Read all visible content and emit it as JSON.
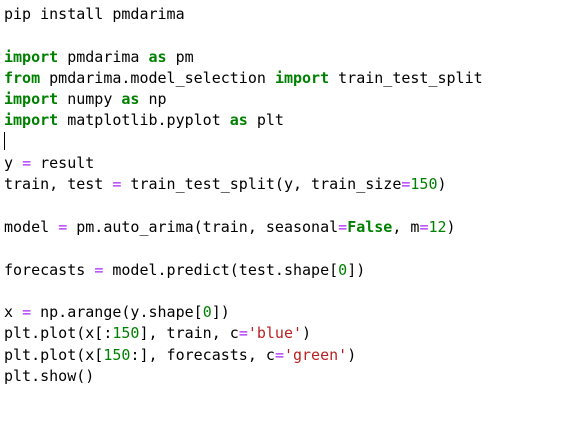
{
  "cell": {
    "lines": [
      {
        "tokens": [
          {
            "t": "pip install pmdarima",
            "c": "plain"
          }
        ]
      },
      {
        "tokens": []
      },
      {
        "tokens": [
          {
            "t": "import",
            "c": "kw"
          },
          {
            "t": " pmdarima ",
            "c": "plain"
          },
          {
            "t": "as",
            "c": "kw"
          },
          {
            "t": " pm",
            "c": "plain"
          }
        ]
      },
      {
        "tokens": [
          {
            "t": "from",
            "c": "kw"
          },
          {
            "t": " pmdarima.model_selection ",
            "c": "plain"
          },
          {
            "t": "import",
            "c": "kw"
          },
          {
            "t": " train_test_split",
            "c": "plain"
          }
        ]
      },
      {
        "tokens": [
          {
            "t": "import",
            "c": "kw"
          },
          {
            "t": " numpy ",
            "c": "plain"
          },
          {
            "t": "as",
            "c": "kw"
          },
          {
            "t": " np",
            "c": "plain"
          }
        ]
      },
      {
        "tokens": [
          {
            "t": "import",
            "c": "kw"
          },
          {
            "t": " matplotlib.pyplot ",
            "c": "plain"
          },
          {
            "t": "as",
            "c": "kw"
          },
          {
            "t": " plt",
            "c": "plain"
          }
        ]
      },
      {
        "tokens": [],
        "cursor": true
      },
      {
        "tokens": [
          {
            "t": "y ",
            "c": "plain"
          },
          {
            "t": "=",
            "c": "op"
          },
          {
            "t": " result",
            "c": "plain"
          }
        ]
      },
      {
        "tokens": [
          {
            "t": "train, test ",
            "c": "plain"
          },
          {
            "t": "=",
            "c": "op"
          },
          {
            "t": " train_test_split(y, train_size",
            "c": "plain"
          },
          {
            "t": "=",
            "c": "op"
          },
          {
            "t": "150",
            "c": "num"
          },
          {
            "t": ")",
            "c": "plain"
          }
        ]
      },
      {
        "tokens": []
      },
      {
        "tokens": [
          {
            "t": "model ",
            "c": "plain"
          },
          {
            "t": "=",
            "c": "op"
          },
          {
            "t": " pm.auto_arima(train, seasonal",
            "c": "plain"
          },
          {
            "t": "=",
            "c": "op"
          },
          {
            "t": "False",
            "c": "kw"
          },
          {
            "t": ", m",
            "c": "plain"
          },
          {
            "t": "=",
            "c": "op"
          },
          {
            "t": "12",
            "c": "num"
          },
          {
            "t": ")",
            "c": "plain"
          }
        ]
      },
      {
        "tokens": []
      },
      {
        "tokens": [
          {
            "t": "forecasts ",
            "c": "plain"
          },
          {
            "t": "=",
            "c": "op"
          },
          {
            "t": " model.predict(test.shape[",
            "c": "plain"
          },
          {
            "t": "0",
            "c": "num"
          },
          {
            "t": "])",
            "c": "plain"
          }
        ]
      },
      {
        "tokens": []
      },
      {
        "tokens": [
          {
            "t": "x ",
            "c": "plain"
          },
          {
            "t": "=",
            "c": "op"
          },
          {
            "t": " np.arange(y.shape[",
            "c": "plain"
          },
          {
            "t": "0",
            "c": "num"
          },
          {
            "t": "])",
            "c": "plain"
          }
        ]
      },
      {
        "tokens": [
          {
            "t": "plt.plot(x[:",
            "c": "plain"
          },
          {
            "t": "150",
            "c": "num"
          },
          {
            "t": "], train, c",
            "c": "plain"
          },
          {
            "t": "=",
            "c": "op"
          },
          {
            "t": "'blue'",
            "c": "str"
          },
          {
            "t": ")",
            "c": "plain"
          }
        ]
      },
      {
        "tokens": [
          {
            "t": "plt.plot(x[",
            "c": "plain"
          },
          {
            "t": "150",
            "c": "num"
          },
          {
            "t": ":], forecasts, c",
            "c": "plain"
          },
          {
            "t": "=",
            "c": "op"
          },
          {
            "t": "'green'",
            "c": "str"
          },
          {
            "t": ")",
            "c": "plain"
          }
        ]
      },
      {
        "tokens": [
          {
            "t": "plt.show()",
            "c": "plain"
          }
        ]
      }
    ]
  },
  "colors": {
    "keyword": "#008000",
    "operator": "#aa22ff",
    "number": "#008000",
    "string": "#ba2121",
    "text": "#000000",
    "background": "#ffffff"
  }
}
